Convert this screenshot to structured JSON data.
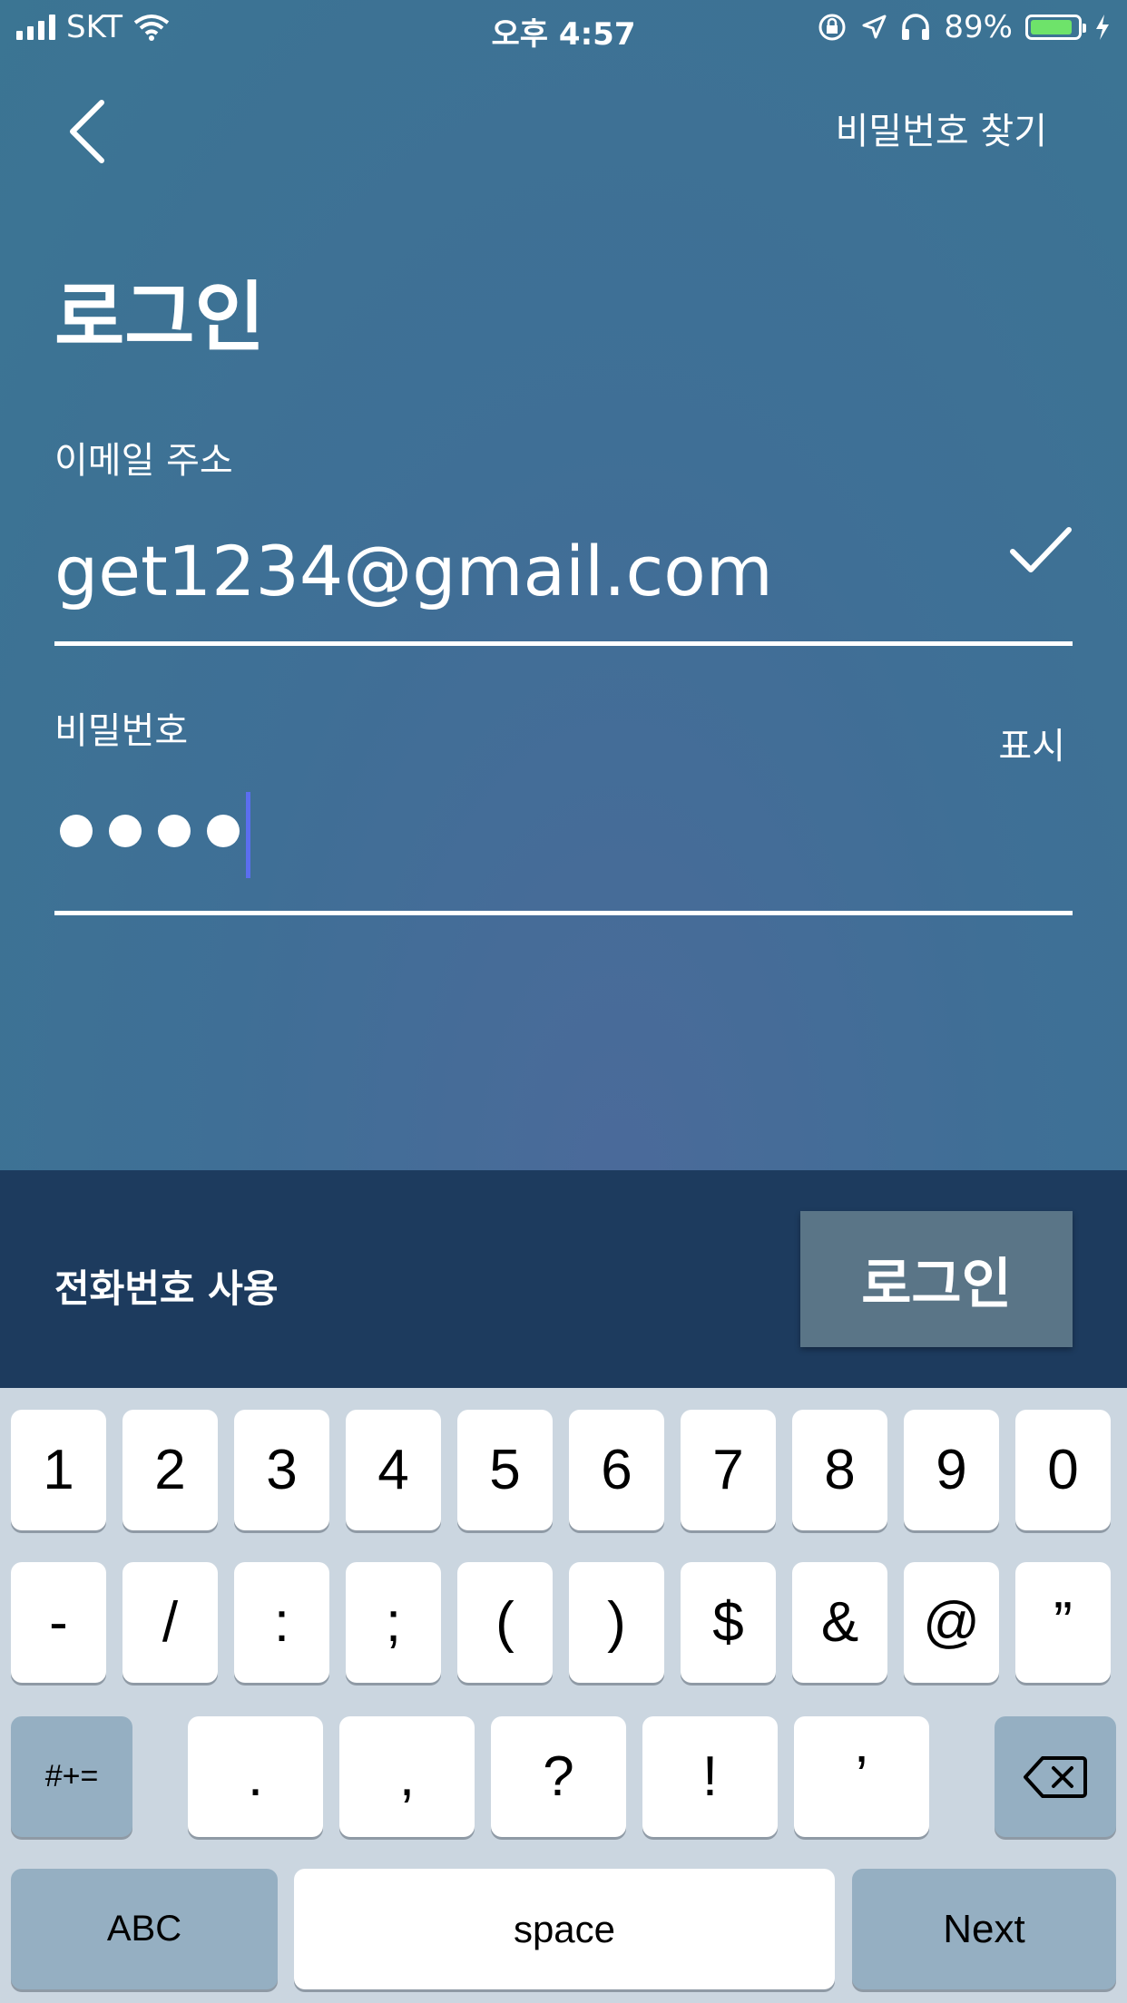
{
  "status_bar": {
    "carrier": "SKT",
    "time": "오후 4:57",
    "battery": "89%",
    "battery_level": 0.89,
    "icons": [
      "signal-bars-icon",
      "wifi-icon",
      "orientation-lock-icon",
      "location-arrow-icon",
      "headphones-icon",
      "battery-icon",
      "charging-bolt-icon"
    ]
  },
  "header": {
    "back_icon": "chevron-left-icon",
    "find_password": "비밀번호 찾기"
  },
  "title": "로그인",
  "email": {
    "label": "이메일 주소",
    "value": "get1234@gmail.com",
    "valid_icon": "checkmark-icon"
  },
  "password": {
    "label": "비밀번호",
    "show": "표시",
    "masked_count": 4
  },
  "action_bar": {
    "use_phone": "전화번호 사용",
    "login": "로그인"
  },
  "keyboard": {
    "row1": [
      "1",
      "2",
      "3",
      "4",
      "5",
      "6",
      "7",
      "8",
      "9",
      "0"
    ],
    "row2": [
      "-",
      "/",
      ":",
      ";",
      "(",
      ")",
      "$",
      "&",
      "@",
      "”"
    ],
    "row3_left": "#+=",
    "row3": [
      ".",
      ",",
      "?",
      "!",
      "’"
    ],
    "backspace_icon": "backspace-icon",
    "abc": "ABC",
    "space": "space",
    "next": "Next"
  },
  "colors": {
    "background_top": "#3b7593",
    "background_center": "#4b6a9a",
    "action_bar": "#1d3b5e",
    "login_button": "#5a7587",
    "caret": "#5b6ef0",
    "keyboard_bg": "#cbd6e0",
    "key_dark": "#95afc2"
  }
}
